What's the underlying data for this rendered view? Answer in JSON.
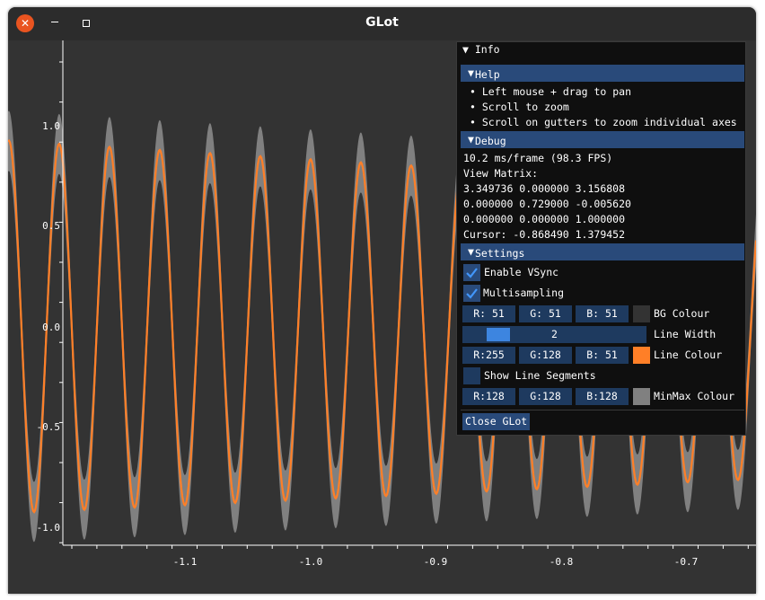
{
  "window": {
    "title": "GLot",
    "close_glyph": "✕"
  },
  "plot": {
    "y_ticks": [
      "1.0",
      "0.5",
      "0.0",
      "-0.5",
      "-1.0"
    ],
    "x_ticks": [
      "-1.1",
      "-1.0",
      "-0.9",
      "-0.8",
      "-0.7"
    ],
    "bg_color": "#333333",
    "line_color": "#ff7f27",
    "minmax_color": "#808080"
  },
  "info_panel": {
    "title": "Info",
    "help": {
      "header": "Help",
      "items": [
        "Left mouse + drag to pan",
        "Scroll to zoom",
        "Scroll on gutters to zoom individual axes"
      ]
    },
    "debug": {
      "header": "Debug",
      "frame_time": "10.2 ms/frame (98.3 FPS)",
      "view_matrix_label": "View Matrix:",
      "matrix_rows": [
        "3.349736 0.000000 3.156808",
        "0.000000 0.729000 -0.005620",
        "0.000000 0.000000 1.000000"
      ],
      "cursor": "Cursor: -0.868490 1.379452"
    },
    "settings": {
      "header": "Settings",
      "vsync_label": "Enable VSync",
      "multisampling_label": "Multisampling",
      "bg": {
        "r": "R: 51",
        "g": "G: 51",
        "b": "B: 51",
        "label": "BG Colour"
      },
      "line_width": {
        "value": "2",
        "label": "Line Width"
      },
      "line": {
        "r": "R:255",
        "g": "G:128",
        "b": "B: 51",
        "label": "Line Colour"
      },
      "segments_label": "Show Line Segments",
      "minmax": {
        "r": "R:128",
        "g": "G:128",
        "b": "B:128",
        "label": "MinMax Colour"
      },
      "close_button": "Close GLot"
    }
  }
}
